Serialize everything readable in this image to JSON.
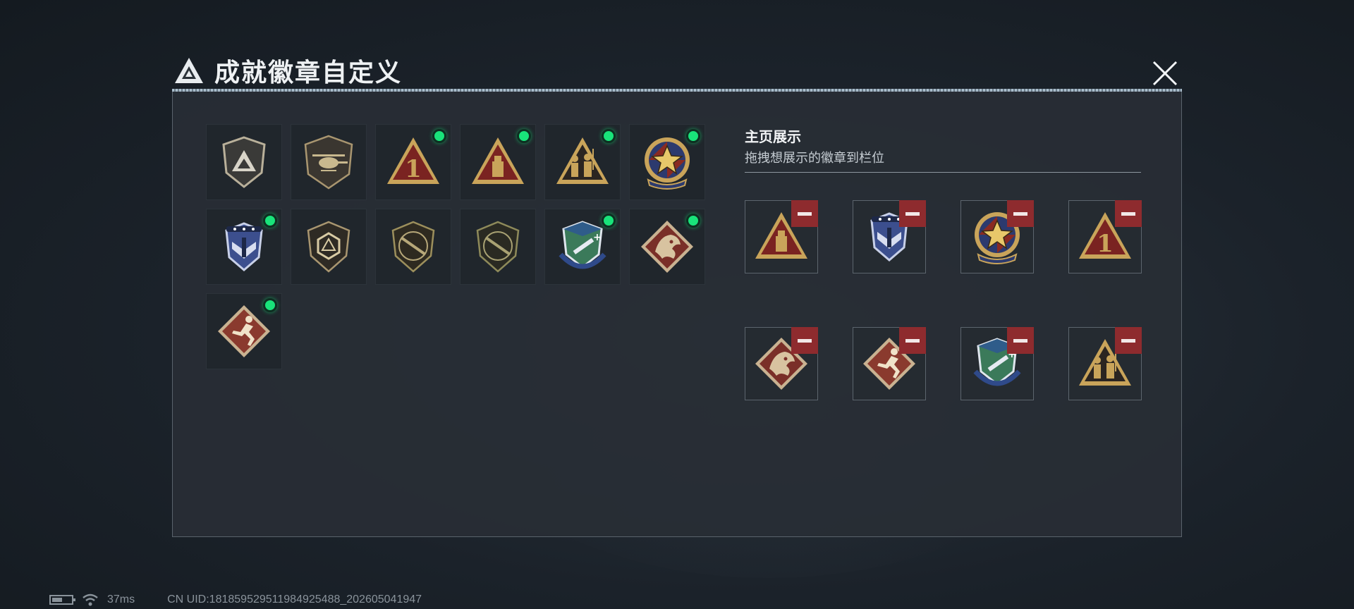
{
  "window": {
    "title": "成就徽章自定义",
    "close_icon": "close-icon"
  },
  "inventory": [
    {
      "icon": "shield-logo-badge",
      "new": false
    },
    {
      "icon": "helicopter-badge",
      "new": false
    },
    {
      "icon": "triangle-one-badge",
      "new": true
    },
    {
      "icon": "triangle-drive-badge",
      "new": true
    },
    {
      "icon": "triangle-soldiers-badge",
      "new": true
    },
    {
      "icon": "star-emblem-badge",
      "new": true
    },
    {
      "icon": "blue-wing-shield-badge",
      "new": true
    },
    {
      "icon": "shield-d20-badge",
      "new": false
    },
    {
      "icon": "shield-rifle-badge",
      "new": false
    },
    {
      "icon": "shield-rifle-badge-2",
      "new": false
    },
    {
      "icon": "green-crest-badge",
      "new": true
    },
    {
      "icon": "dragon-diamond-badge",
      "new": true
    },
    {
      "icon": "runner-diamond-badge",
      "new": true
    }
  ],
  "showcase": {
    "title": "主页展示",
    "subtitle": "拖拽想展示的徽章到栏位",
    "slots": [
      {
        "icon": "triangle-drive-badge"
      },
      {
        "icon": "blue-wing-shield-badge"
      },
      {
        "icon": "star-emblem-badge"
      },
      {
        "icon": "triangle-one-badge"
      },
      {
        "icon": "dragon-diamond-badge"
      },
      {
        "icon": "runner-diamond-badge"
      },
      {
        "icon": "green-crest-badge"
      },
      {
        "icon": "triangle-soldiers-badge"
      }
    ]
  },
  "status": {
    "ping": "37ms",
    "uid": "CN UID:18185952951198492548​8_202605041947"
  },
  "colors": {
    "new_dot": "#19e37a",
    "remove": "#8e2b2e",
    "badge_red": "#7a2321",
    "badge_gold": "#c9a45a"
  }
}
